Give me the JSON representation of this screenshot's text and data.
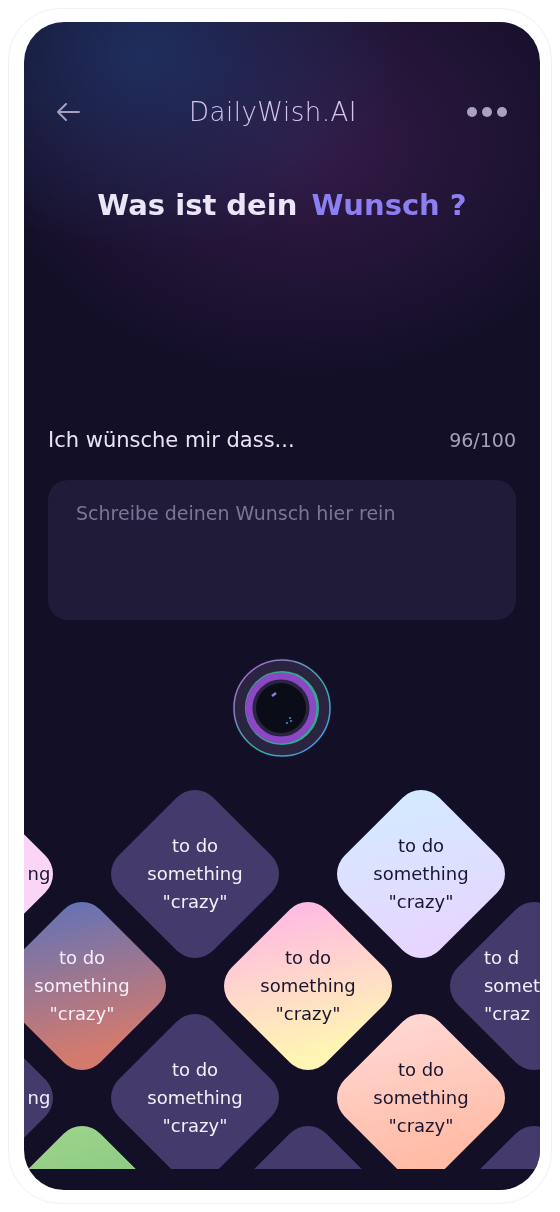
{
  "header": {
    "title": "DailyWish.AI"
  },
  "heading": {
    "text": "Was ist dein",
    "highlight": "Wunsch ?"
  },
  "wish": {
    "label": "Ich wünsche mir dass...",
    "counter": "96/100",
    "placeholder": "Schreibe deinen Wunsch hier rein"
  },
  "tile_rows": [
    [
      {
        "kind": "pink",
        "text": "ng"
      },
      {
        "kind": "dark",
        "text": "to do\nsomething\n\"crazy\""
      },
      {
        "kind": "sky",
        "text": "to do\nsomething\n\"crazy\""
      }
    ],
    [
      {
        "kind": "dusk",
        "text": "to do\nsomething\n\"crazy\""
      },
      {
        "kind": "candy",
        "text": "to do\nsomething\n\"crazy\""
      },
      {
        "kind": "dark",
        "text": "to d\nsomet\n\"craz"
      }
    ],
    [
      {
        "kind": "dark",
        "text": "ng"
      },
      {
        "kind": "dark",
        "text": "to do\nsomething\n\"crazy\""
      },
      {
        "kind": "peach",
        "text": "to do\nsomething\n\"crazy\""
      }
    ],
    [
      {
        "kind": "mint"
      },
      {
        "kind": "dark"
      },
      {
        "kind": "dark"
      }
    ]
  ]
}
